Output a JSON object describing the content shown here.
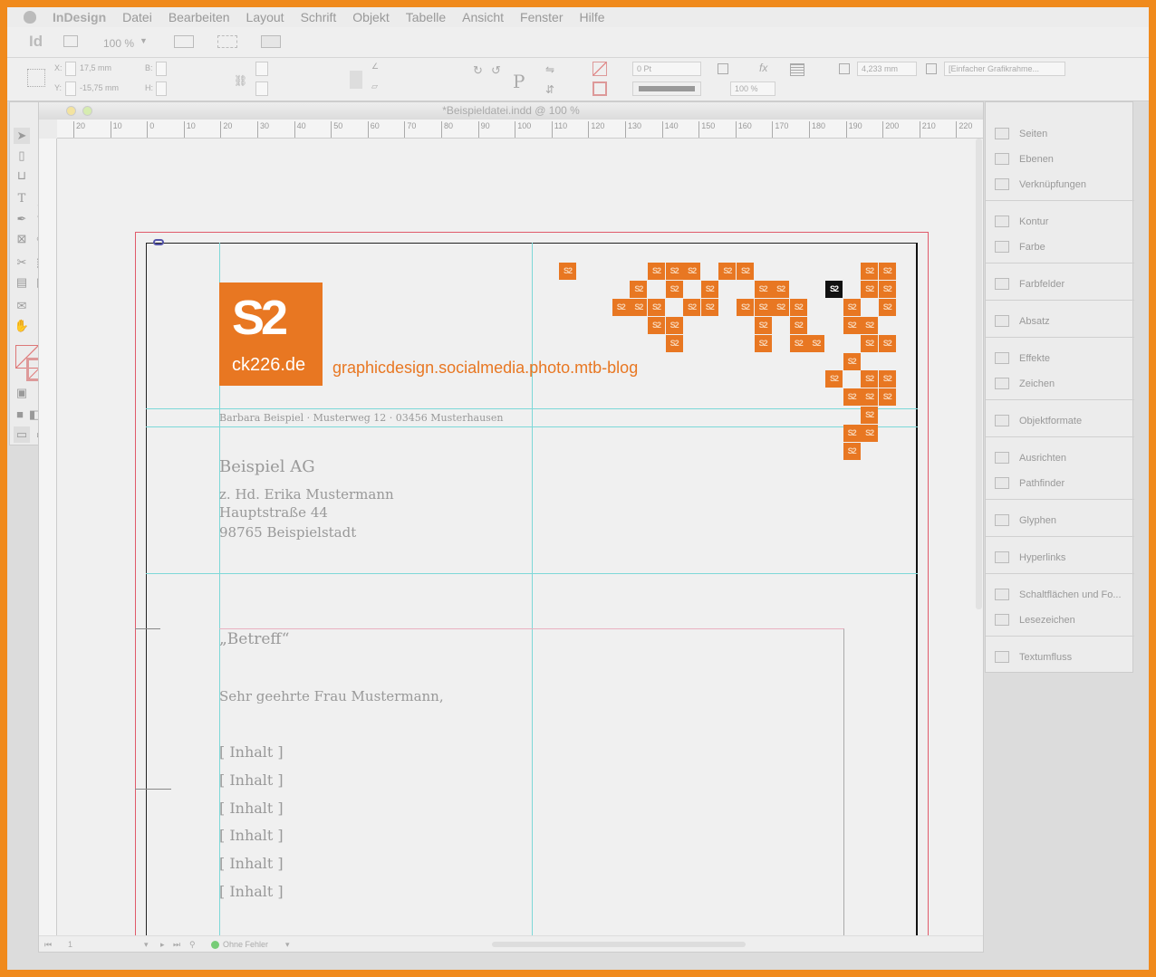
{
  "menu": {
    "apple": "",
    "app": "InDesign",
    "items": [
      "Datei",
      "Bearbeiten",
      "Layout",
      "Schrift",
      "Objekt",
      "Tabelle",
      "Ansicht",
      "Fenster",
      "Hilfe"
    ]
  },
  "appbar": {
    "logo": "Id",
    "zoom": "100 %"
  },
  "control": {
    "x_label": "X:",
    "x_value": "17,5 mm",
    "y_label": "Y:",
    "y_value": "-15,75 mm",
    "w_label": "B:",
    "h_label": "H:",
    "stroke_weight": "0 Pt",
    "opacity": "100 %",
    "offset": "4,233 mm",
    "object_style": "[Einfacher Grafikrahme..."
  },
  "document": {
    "title": "*Beispieldatei.indd @ 100 %",
    "ruler_ticks": [
      "20",
      "10",
      "0",
      "10",
      "20",
      "30",
      "40",
      "50",
      "60",
      "70",
      "80",
      "90",
      "100",
      "110",
      "120",
      "130",
      "140",
      "150",
      "160",
      "170",
      "180",
      "190",
      "200",
      "210",
      "220"
    ]
  },
  "letter": {
    "logo_text": "ck226.de",
    "tagline": "graphicdesign.socialmedia.photo.mtb-blog",
    "sender": "Barbara Beispiel · Musterweg 12 · 03456 Musterhausen",
    "recipient_company": "Beispiel AG",
    "recipient_lines": [
      "z. Hd. Erika Mustermann",
      "Hauptstraße 44",
      "98765 Beispielstadt"
    ],
    "subject": "„Betreff“",
    "salutation": "Sehr geehrte Frau Mustermann,",
    "content_lines": [
      "[ Inhalt ]",
      "[ Inhalt ]",
      "[ Inhalt ]",
      "[ Inhalt ]",
      "[ Inhalt ]",
      "[ Inhalt ]"
    ],
    "tile_glyph": "S2"
  },
  "status": {
    "page": "1",
    "preflight": "Ohne Fehler"
  },
  "panels": [
    "Seiten",
    "Ebenen",
    "Verknüpfungen",
    "Kontur",
    "Farbe",
    "Farbfelder",
    "Absatz",
    "Effekte",
    "Zeichen",
    "Objektformate",
    "Ausrichten",
    "Pathfinder",
    "Glyphen",
    "Hyperlinks",
    "Schaltflächen und Fo...",
    "Lesezeichen",
    "Textumfluss"
  ],
  "colors": {
    "accent": "#e87722",
    "guide": "#7dd8d8",
    "bleed": "#e05a6a"
  }
}
